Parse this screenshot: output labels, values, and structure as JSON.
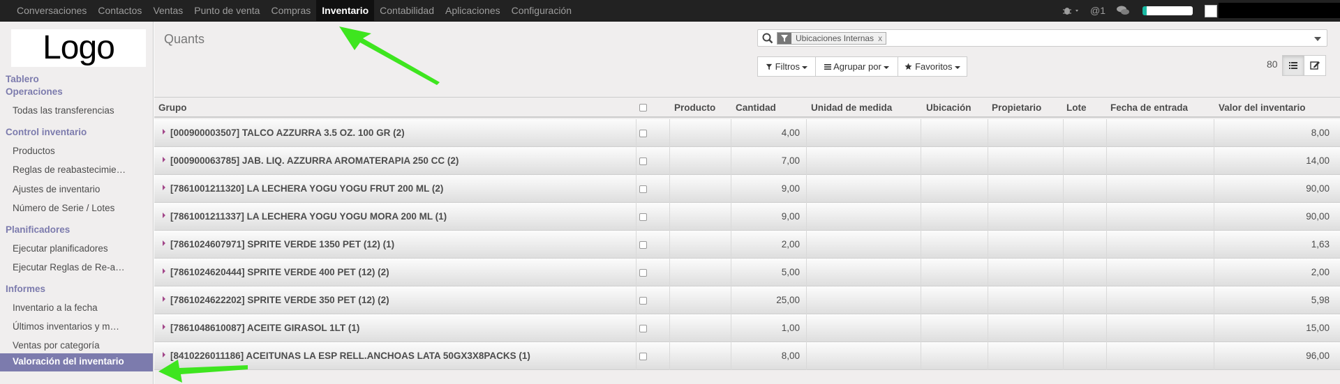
{
  "navbar": {
    "menu": [
      "Conversaciones",
      "Contactos",
      "Ventas",
      "Punto de venta",
      "Compras",
      "Inventario",
      "Contabilidad",
      "Aplicaciones",
      "Configuración"
    ],
    "active_index": 5,
    "mention": "@1"
  },
  "sidebar": {
    "logo": "Logo",
    "sections": [
      {
        "title": "Tablero",
        "items": []
      },
      {
        "title": "Operaciones",
        "items": [
          "Todas las transferencias"
        ]
      },
      {
        "title": "Control inventario",
        "items": [
          "Productos",
          "Reglas de reabastecimie…",
          "Ajustes de inventario",
          "Número de Serie / Lotes"
        ]
      },
      {
        "title": "Planificadores",
        "items": [
          "Ejecutar planificadores",
          "Ejecutar Reglas de Re-a…"
        ]
      },
      {
        "title": "Informes",
        "items": [
          "Inventario a la fecha",
          "Últimos inventarios y m…",
          "Ventas por categoría",
          "Valoración del inventario"
        ]
      }
    ],
    "active_item": "Valoración del inventario"
  },
  "main": {
    "title": "Quants",
    "search": {
      "facet": "Ubicaciones Internas",
      "facet_close": "x"
    },
    "buttons": {
      "filters": "Filtros",
      "group_by": "Agrupar por",
      "favorites": "Favoritos"
    },
    "pager": "80"
  },
  "table": {
    "columns": [
      "Grupo",
      "Producto",
      "Cantidad",
      "Unidad de medida",
      "Ubicación",
      "Propietario",
      "Lote",
      "Fecha de entrada",
      "Valor del inventario"
    ],
    "rows": [
      {
        "group": "[000900003507] TALCO AZZURRA 3.5 OZ. 100 GR (2)",
        "qty": "4,00",
        "value": "8,00"
      },
      {
        "group": "[000900063785] JAB. LIQ. AZZURRA AROMATERAPIA 250 CC (2)",
        "qty": "7,00",
        "value": "14,00"
      },
      {
        "group": "[7861001211320] LA LECHERA YOGU YOGU FRUT 200 ML (2)",
        "qty": "9,00",
        "value": "90,00"
      },
      {
        "group": "[7861001211337] LA LECHERA YOGU YOGU MORA 200 ML (1)",
        "qty": "9,00",
        "value": "90,00"
      },
      {
        "group": "[7861024607971] SPRITE VERDE 1350 PET (12) (1)",
        "qty": "2,00",
        "value": "1,63"
      },
      {
        "group": "[7861024620444] SPRITE VERDE 400 PET (12) (2)",
        "qty": "5,00",
        "value": "2,00"
      },
      {
        "group": "[7861024622202] SPRITE VERDE 350 PET (12) (2)",
        "qty": "25,00",
        "value": "5,98"
      },
      {
        "group": "[7861048610087] ACEITE GIRASOL 1LT (1)",
        "qty": "1,00",
        "value": "15,00"
      },
      {
        "group": "[8410226011186] ACEITUNAS LA ESP RELL.ANCHOAS LATA 50GX3X8PACKS (1)",
        "qty": "8,00",
        "value": "96,00"
      }
    ]
  },
  "colors": {
    "brand": "#7c7bad",
    "navbar": "#222222",
    "arrow": "#3ee51f",
    "caret": "#a24689"
  }
}
